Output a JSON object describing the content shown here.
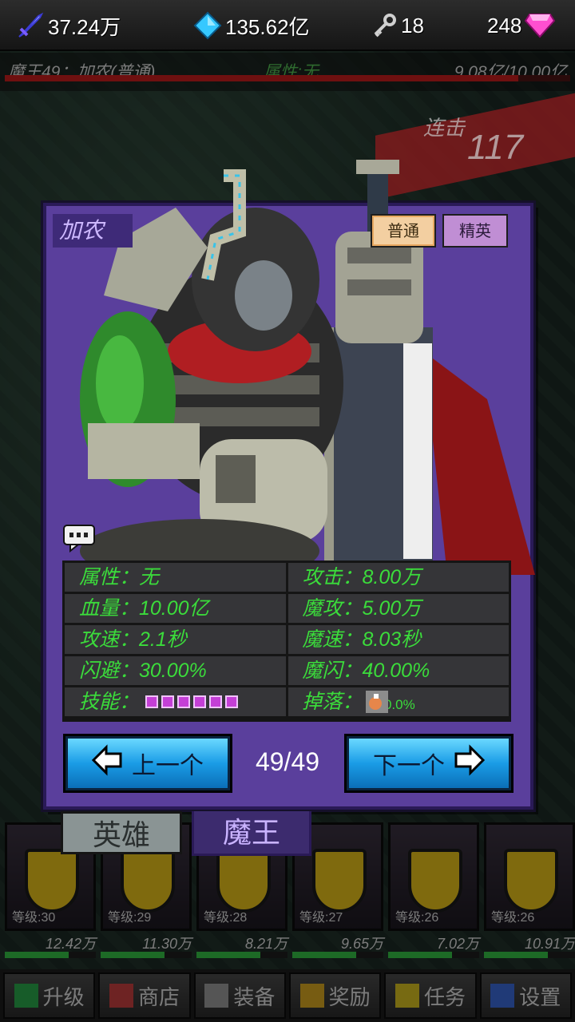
{
  "topbar": {
    "attack_power": "37.24万",
    "crystals": "135.62亿",
    "keys": "18",
    "gems": "248"
  },
  "boss_bar": {
    "name": "魔王49：加农(普通)",
    "attribute": "属性:无",
    "hp_text": "9.08亿/10.00亿",
    "hp_fraction": 0.908
  },
  "combo": {
    "label": "连击",
    "count": "117"
  },
  "panel": {
    "boss_name": "加农",
    "modes": {
      "normal": "普通",
      "elite": "精英"
    },
    "stats": {
      "attribute": "属性：无",
      "attack": "攻击：8.00万",
      "hp": "血量：10.00亿",
      "magic_attack": "魔攻：5.00万",
      "attack_speed": "攻速：2.1秒",
      "magic_speed": "魔速：8.03秒",
      "dodge": "闪避：30.00%",
      "magic_dodge": "魔闪：40.00%",
      "skills": "技能：",
      "skill_count": 6,
      "drop": "掉落：",
      "drop_pct": "30.0%"
    },
    "prev_label": "上一个",
    "next_label": "下一个",
    "counter": "49/49"
  },
  "tabs": {
    "hero": "英雄",
    "boss": "魔王"
  },
  "heroes": [
    {
      "level": "等级:30",
      "power": "12.42万"
    },
    {
      "level": "等级:29",
      "power": "11.30万"
    },
    {
      "level": "等级:28",
      "power": "8.21万"
    },
    {
      "level": "等级:27",
      "power": "9.65万"
    },
    {
      "level": "等级:26",
      "power": "7.02万"
    },
    {
      "level": "等级:26",
      "power": "10.91万"
    }
  ],
  "bottom_nav": [
    "升级",
    "商店",
    "装备",
    "奖励",
    "任务",
    "设置"
  ],
  "colors": {
    "panel": "#5a3f9c",
    "stat_text": "#3bdc3b",
    "nav_button": "#1a9ce6"
  }
}
